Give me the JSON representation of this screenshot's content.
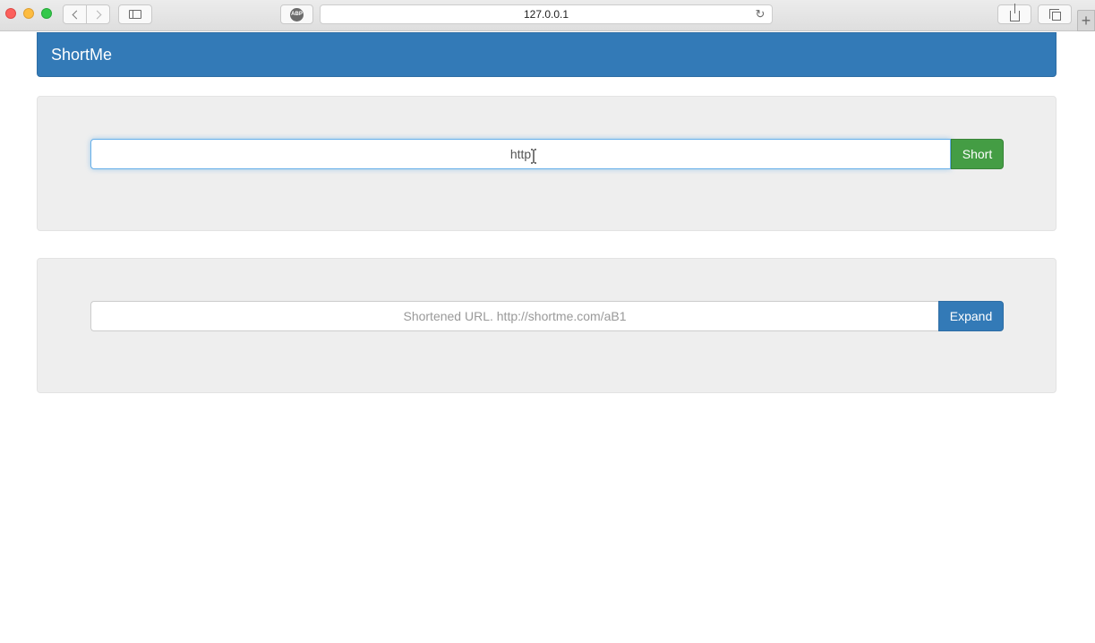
{
  "browser": {
    "url": "127.0.0.1",
    "abp_label": "ABP"
  },
  "navbar": {
    "brand": "ShortMe"
  },
  "shorten_form": {
    "input_value": "http",
    "button_label": "Short"
  },
  "expand_form": {
    "input_value": "",
    "placeholder": "Shortened URL. http://shortme.com/aB1",
    "button_label": "Expand"
  },
  "colors": {
    "navbar": "#337ab7",
    "short_button": "#449d44",
    "expand_button": "#337ab7",
    "well_background": "#eeeeee"
  }
}
